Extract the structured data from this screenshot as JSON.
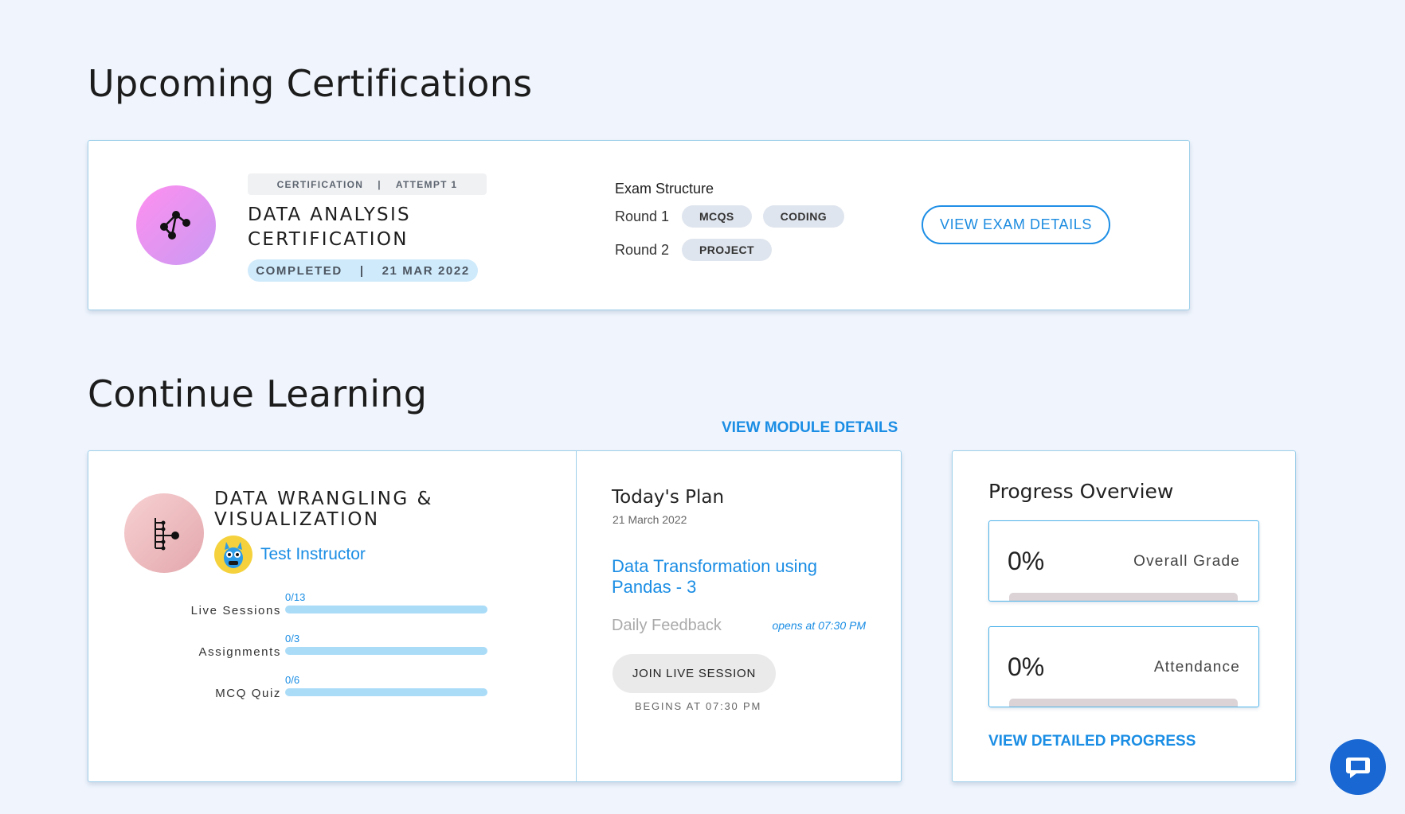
{
  "sections": {
    "upcoming_title": "Upcoming Certifications",
    "continue_title": "Continue Learning"
  },
  "certification": {
    "type_tag": "CERTIFICATION",
    "separator": "|",
    "attempt_tag": "ATTEMPT 1",
    "name": "DATA ANALYSIS CERTIFICATION",
    "status": "COMPLETED",
    "date": "21 MAR 2022",
    "exam_structure_label": "Exam Structure",
    "rounds": [
      {
        "label": "Round 1",
        "chips": [
          "MCQS",
          "CODING"
        ]
      },
      {
        "label": "Round 2",
        "chips": [
          "PROJECT"
        ]
      }
    ],
    "view_details_label": "VIEW EXAM DETAILS",
    "logo_icon": "graph-nodes-icon"
  },
  "module": {
    "view_module_label": "VIEW MODULE DETAILS",
    "name": "DATA WRANGLING & VISUALIZATION",
    "instructor": "Test Instructor",
    "logo_icon": "tree-nodes-icon",
    "progress": [
      {
        "label": "Live Sessions",
        "count": "0/13",
        "value": 0
      },
      {
        "label": "Assignments",
        "count": "0/3",
        "value": 0
      },
      {
        "label": "MCQ Quiz",
        "count": "0/6",
        "value": 0
      }
    ]
  },
  "plan": {
    "title": "Today's Plan",
    "date": "21 March 2022",
    "session": "Data Transformation using Pandas - 3",
    "feedback": "Daily Feedback",
    "opens": "opens at 07:30 PM",
    "join_label": "JOIN LIVE SESSION",
    "begins": "BEGINS AT 07:30 PM"
  },
  "progress_overview": {
    "title": "Progress Overview",
    "metrics": [
      {
        "value": "0%",
        "label": "Overall Grade"
      },
      {
        "value": "0%",
        "label": "Attendance"
      }
    ],
    "view_detailed_label": "VIEW DETAILED PROGRESS"
  },
  "colors": {
    "accent": "#1a8de4",
    "background": "#f0f5fd",
    "chat_button": "#1967d2"
  }
}
